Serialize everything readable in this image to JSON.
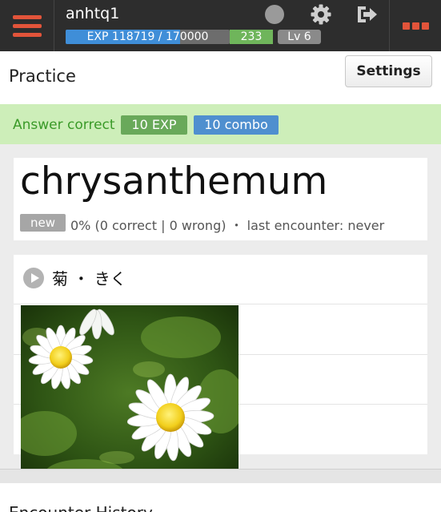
{
  "user": {
    "name": "anhtq1",
    "exp_text": "EXP 118719 / 170000",
    "exp_progress": 0.698,
    "count": "233",
    "level": "Lv 6"
  },
  "icons": {
    "menu": "hamburger-menu-icon",
    "status": "status-dot-icon",
    "settings": "gear-icon",
    "logout": "logout-icon",
    "more": "more-dots-icon",
    "play": "play-circle-icon"
  },
  "colors": {
    "accent": "#e2543a",
    "exp_bar": "#3f8ed8",
    "success_bg": "#cdeeb9",
    "success_text": "#3a9a28",
    "exp_badge": "#69a95a",
    "combo_badge": "#4f8fcf"
  },
  "header": {
    "title": "Practice",
    "settings_label": "Settings"
  },
  "answer": {
    "status": "Answer correct",
    "exp_badge": "10 EXP",
    "combo_badge": "10 combo"
  },
  "word": {
    "text": "chrysanthemum",
    "badge": "new",
    "stats": "0% (0 correct | 0 wrong) ・ last encounter: never"
  },
  "reading": {
    "text": "菊 ・ きく"
  },
  "history": {
    "title": "Encounter History"
  }
}
